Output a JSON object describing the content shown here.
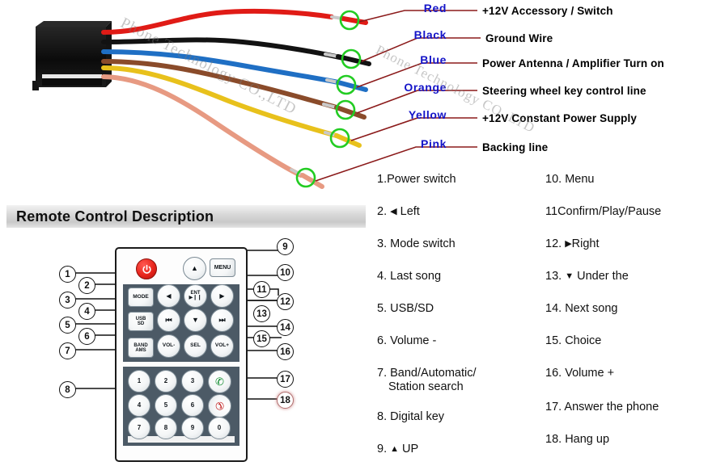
{
  "watermark": "Phone Technology CO.,LTD",
  "wiring": {
    "connector_label": "harness-connector",
    "wires": [
      {
        "color_name": "Red",
        "description": "+12V  Accessory / Switch",
        "hex": "#e01b16"
      },
      {
        "color_name": "Black",
        "description": "Ground Wire",
        "hex": "#121212"
      },
      {
        "color_name": "Blue",
        "description": "Power Antenna / Amplifier Turn on",
        "hex": "#1f6fc4"
      },
      {
        "color_name": "Orange",
        "description": "Steering wheel key control line",
        "hex": "#8a4b2a"
      },
      {
        "color_name": "Yellow",
        "description": "+12V Constant Power Supply",
        "hex": "#e8c11c"
      },
      {
        "color_name": "Pink",
        "description": "Backing line",
        "hex": "#e79a82"
      }
    ],
    "label_color": "#1414c8",
    "leader_color": "#8b1a1a",
    "terminal_marker_color": "#22cc22"
  },
  "remote_section": {
    "title": "Remote Control Description",
    "buttons": {
      "power": "",
      "up": "▲",
      "menu": "MENU",
      "mode": "MODE",
      "left": "◀",
      "ent": "ENT",
      "ent_sub": "▶❙❙",
      "right": "▶",
      "usb": "USB",
      "usb_sub": "SD",
      "prev": "⏮",
      "down": "▼",
      "next": "⏭",
      "band": "BAND",
      "band_sub": "AMS",
      "vol_down": "VOL-",
      "sel": "SEL",
      "vol_up": "VOL+",
      "answer": "✆",
      "hangup": "✆"
    },
    "keypad": [
      "1",
      "2",
      "3",
      "4",
      "5",
      "6",
      "7",
      "8",
      "9",
      "0"
    ],
    "callouts": [
      "1",
      "2",
      "3",
      "4",
      "5",
      "6",
      "7",
      "8",
      "9",
      "10",
      "11",
      "12",
      "13",
      "14",
      "15",
      "16",
      "17",
      "18"
    ]
  },
  "legend": {
    "left_column": [
      {
        "num": "1.",
        "text": "Power switch"
      },
      {
        "num": "2.",
        "arrow": "◀",
        "text": "Left"
      },
      {
        "num": "3.",
        "text": "Mode switch"
      },
      {
        "num": "4.",
        "text": "Last song"
      },
      {
        "num": "5.",
        "text": "USB/SD"
      },
      {
        "num": "6.",
        "text": "Volume -"
      },
      {
        "num": "7.",
        "text": "Band/Automatic/",
        "text2": "Station search"
      },
      {
        "num": "8.",
        "text": "Digital key"
      },
      {
        "num": "9.",
        "arrow": "▲",
        "text": "UP"
      }
    ],
    "right_column": [
      {
        "num": "10.",
        "text": "Menu"
      },
      {
        "num": "11",
        "text": "Confirm/Play/Pause"
      },
      {
        "num": "12.",
        "arrow": "▶",
        "text": "Right"
      },
      {
        "num": "13.",
        "arrow": "▼",
        "text": "Under the"
      },
      {
        "num": "14.",
        "text": "Next song"
      },
      {
        "num": "15.",
        "text": "Choice"
      },
      {
        "num": "16.",
        "text": "Volume +"
      },
      {
        "num": "17.",
        "text": "Answer the phone"
      },
      {
        "num": "18.",
        "text": "Hang up"
      }
    ]
  }
}
